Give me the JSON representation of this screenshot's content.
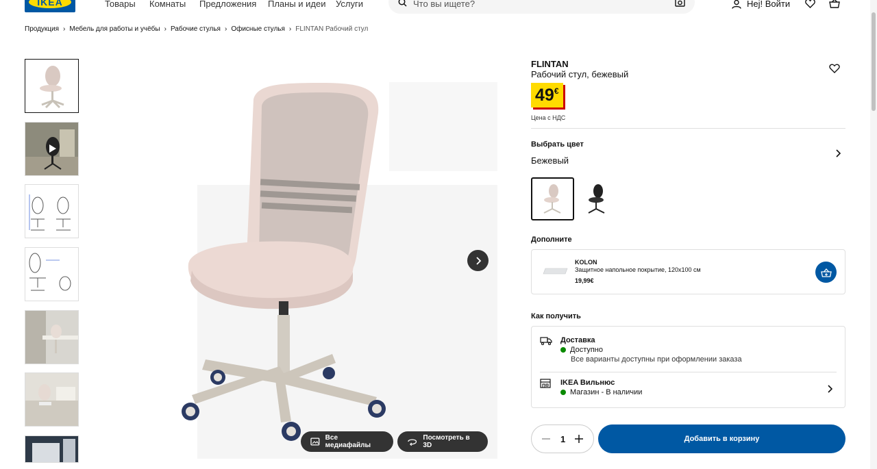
{
  "nav": {
    "logo": "IKEA",
    "links": [
      "Товары",
      "Комнаты",
      "Предложения",
      "Планы и идеи",
      "Услуги"
    ],
    "search_placeholder": "Что вы ищете?",
    "login": "Hej! Войти"
  },
  "breadcrumbs": [
    "Продукция",
    "Мебель для работы и учёбы",
    "Рабочие стулья",
    "Офисные стулья",
    "FLINTAN Рабочий стул"
  ],
  "product": {
    "name": "FLINTAN",
    "description": "Рабочий стул, бежевый",
    "price": "49",
    "currency": "€",
    "vat_note": "Цена с НДС"
  },
  "color": {
    "title": "Выбрать цвет",
    "value": "Бежевый"
  },
  "addon": {
    "title": "Дополните",
    "name": "KOLON",
    "description": "Защитное напольное покрытие, 120x100 см",
    "price": "19,99€"
  },
  "delivery": {
    "title": "Как получить",
    "shipping_title": "Доставка",
    "shipping_status": "Доступно",
    "shipping_note": "Все варианты доступны при оформлении заказа",
    "store_title": "IKEA Вильнюс",
    "store_status": "Магазин - В наличии"
  },
  "gallery": {
    "all_media": "Все медиафайлы",
    "view_3d": "Посмотреть в 3D"
  },
  "cart": {
    "quantity": "1",
    "add_label": "Добавить в корзину"
  },
  "colors": {
    "brand_blue": "#0058a3",
    "brand_yellow": "#ffdb00",
    "price_shadow": "#cc0008",
    "available": "#0a8a00"
  }
}
